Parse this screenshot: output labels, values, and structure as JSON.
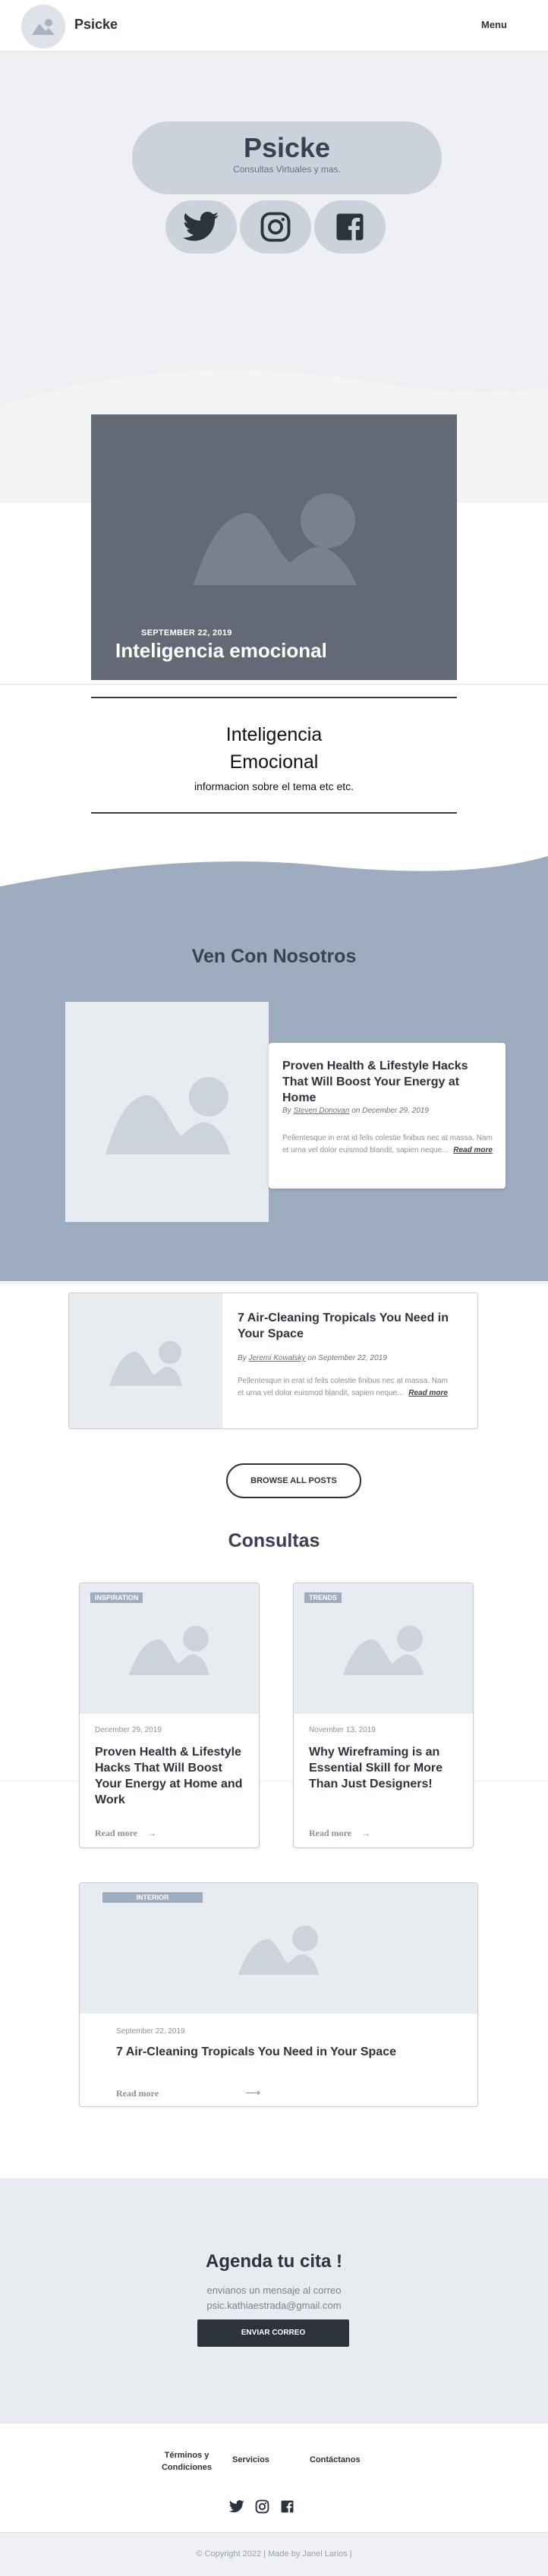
{
  "header": {
    "brand": "Psicke",
    "menu_label": "Menu"
  },
  "hero": {
    "title": "Psicke",
    "subtitle": "Consultas Virtuales y mas.",
    "social": [
      "twitter-icon",
      "instagram-icon",
      "facebook-icon"
    ]
  },
  "featured": {
    "date": "SEPTEMBER 22, 2019",
    "title": "Inteligencia emocional"
  },
  "intro": {
    "title_line1": "Inteligencia",
    "title_line2": "Emocional",
    "text": "informacion sobre el tema etc etc."
  },
  "join": {
    "heading": "Ven Con Nosotros",
    "card": {
      "title": "Proven Health & Lifestyle Hacks That Will Boost Your Energy at Home",
      "by": "By",
      "author": "Steven Donovan",
      "on": "on",
      "date": "December 29, 2019",
      "excerpt": "Pellentesque in erat id felis colestie finibus nec at massa. Nam et urna vel dolor euismod blandit, sapien neque...",
      "read_more": "Read more"
    }
  },
  "post2": {
    "title": "7 Air-Cleaning Tropicals You Need in Your Space",
    "by": "By",
    "author": "Jeremi Kowalsky",
    "on": "on",
    "date": "September 22, 2019",
    "excerpt": "Pellentesque in erat id felis colestie finibus nec at massa. Nam et urna vel dolor euismod blandit, sapien neque...",
    "read_more": "Read more"
  },
  "browse_label": "BROWSE ALL POSTS",
  "consultas": {
    "heading": "Consultas",
    "cards": [
      {
        "tag": "INSPIRATION",
        "date": "December 29, 2019",
        "title": "Proven Health & Lifestyle Hacks That Will Boost Your Energy at Home and Work",
        "read_more": "Read more"
      },
      {
        "tag": "TRENDS",
        "date": "November 13, 2019",
        "title": "Why Wireframing is an Essential Skill for More Than Just Designers!",
        "read_more": "Read more"
      },
      {
        "tag": "INTERIOR",
        "date": "September 22, 2019",
        "title": "7 Air-Cleaning Tropicals You Need in Your Space",
        "read_more": "Read more"
      }
    ]
  },
  "cta": {
    "heading": "Agenda tu cita !",
    "line1": "envianos un mensaje al correo",
    "email": "psic.kathiaestrada@gmail.com",
    "button": "ENVIAR CORREO"
  },
  "footer": {
    "links": [
      "Términos y Condiciones",
      "Servicios",
      "Contáctanos"
    ],
    "copyright": "© Copyright 2022 | Made by Janel Larios |"
  }
}
